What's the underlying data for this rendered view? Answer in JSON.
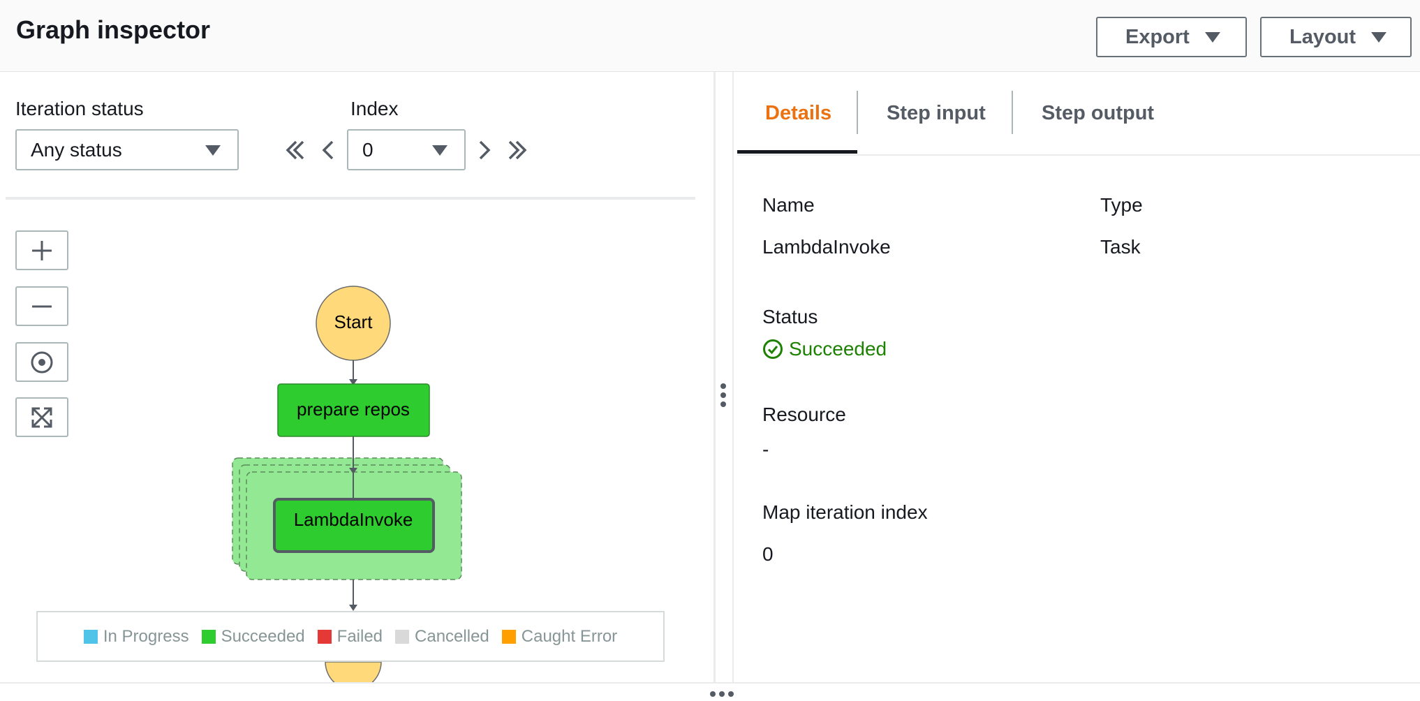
{
  "header": {
    "title": "Graph inspector",
    "export_label": "Export",
    "layout_label": "Layout"
  },
  "filters": {
    "iteration_status_label": "Iteration status",
    "iteration_status_value": "Any status",
    "index_label": "Index",
    "index_value": "0"
  },
  "graph": {
    "nodes": {
      "start": "Start",
      "prepare": "prepare repos",
      "lambda": "LambdaInvoke"
    }
  },
  "legend": {
    "items": [
      {
        "label": "In Progress",
        "color": "#4fc3e8"
      },
      {
        "label": "Succeeded",
        "color": "#2ecc2e"
      },
      {
        "label": "Failed",
        "color": "#e53935"
      },
      {
        "label": "Cancelled",
        "color": "#d9d9d9"
      },
      {
        "label": "Caught Error",
        "color": "#ff9f00"
      }
    ]
  },
  "tabs": [
    {
      "label": "Details"
    },
    {
      "label": "Step input"
    },
    {
      "label": "Step output"
    }
  ],
  "details": {
    "name_label": "Name",
    "name_value": "LambdaInvoke",
    "type_label": "Type",
    "type_value": "Task",
    "status_label": "Status",
    "status_value": "Succeeded",
    "resource_label": "Resource",
    "resource_value": "-",
    "map_index_label": "Map iteration index",
    "map_index_value": "0"
  },
  "colors": {
    "accent_tab": "#ec7211",
    "success": "#1d8102",
    "node_green": "#2ecc2e",
    "map_bg": "#93e893",
    "start_fill": "#ffd97a"
  }
}
